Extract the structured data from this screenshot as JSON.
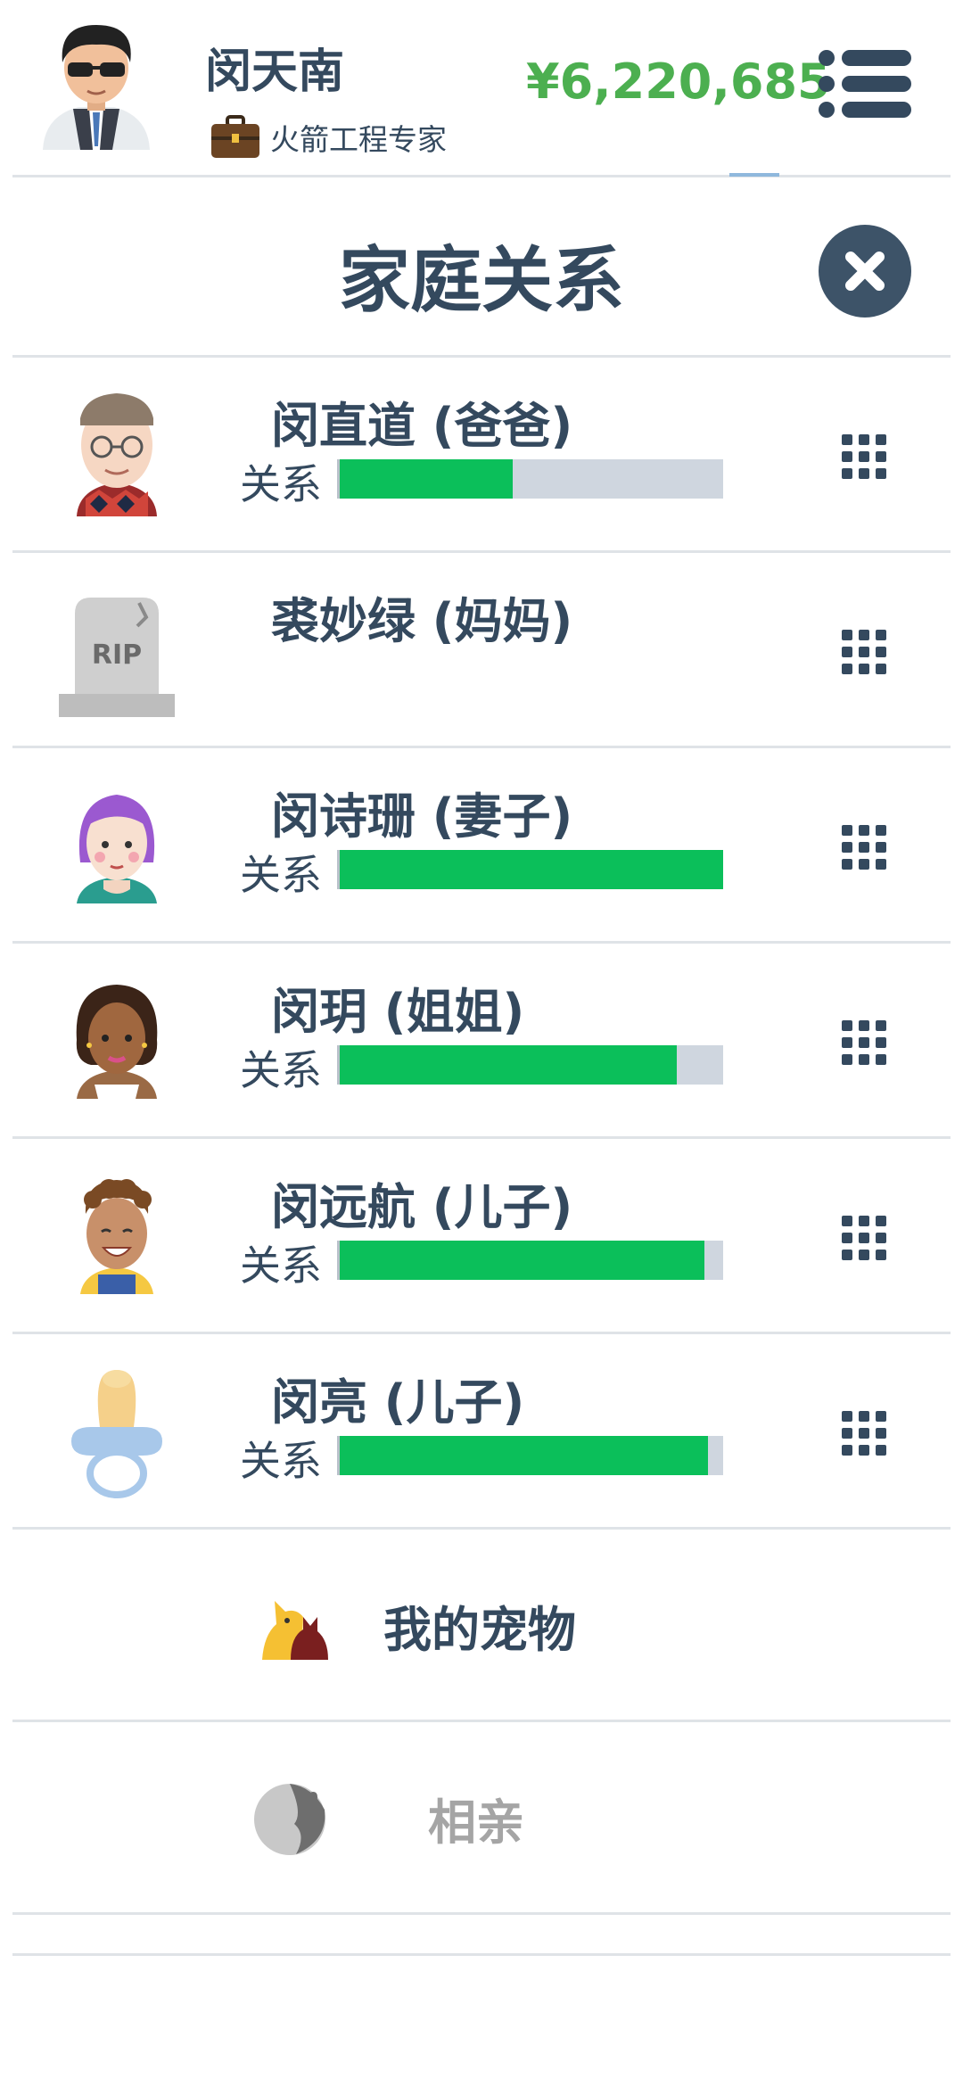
{
  "header": {
    "player_name": "闵天南",
    "job_title": "火箭工程专家",
    "money": "¥6,220,685",
    "icons": {
      "avatar": "player-avatar",
      "job": "briefcase-icon",
      "menu": "menu-list-icon"
    },
    "colors": {
      "money": "#4caf50",
      "text": "#34495e"
    }
  },
  "panel": {
    "title": "家庭关系",
    "close_icon": "close-icon"
  },
  "family": [
    {
      "name": "闵直道 (爸爸)",
      "relation_label": "关系",
      "relation_level": 0.45,
      "deceased": false
    },
    {
      "name": "裘妙绿 (妈妈)",
      "relation_label": "",
      "relation_level": null,
      "deceased": true,
      "tombstone_text": "RIP"
    },
    {
      "name": "闵诗珊 (妻子)",
      "relation_label": "关系",
      "relation_level": 1.0,
      "deceased": false
    },
    {
      "name": "闵玥 (姐姐)",
      "relation_label": "关系",
      "relation_level": 0.88,
      "deceased": false
    },
    {
      "name": "闵远航 (儿子)",
      "relation_label": "关系",
      "relation_level": 0.95,
      "deceased": false
    },
    {
      "name": "闵亮 (儿子)",
      "relation_label": "关系",
      "relation_level": 0.96,
      "deceased": false
    }
  ],
  "links": {
    "pets": {
      "label": "我的宠物",
      "icon": "pet-icon",
      "enabled": true
    },
    "dating": {
      "label": "相亲",
      "icon": "dating-icon",
      "enabled": false
    }
  },
  "colors": {
    "bar_fill": "#0bbf5a",
    "bar_track": "#cfd6df",
    "disabled_text": "#a5a5a5"
  }
}
